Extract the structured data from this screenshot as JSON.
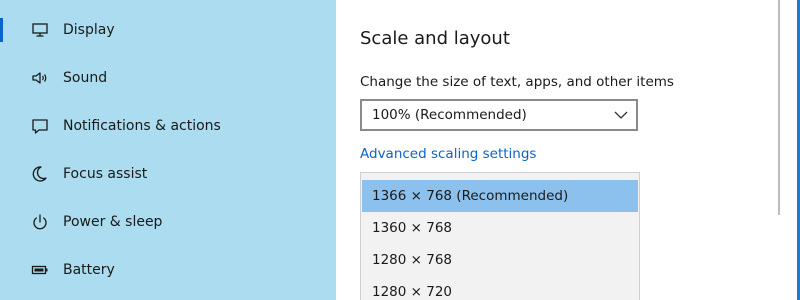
{
  "sidebar": {
    "items": [
      {
        "label": "Display",
        "icon": "monitor-icon",
        "active": true
      },
      {
        "label": "Sound",
        "icon": "speaker-icon",
        "active": false
      },
      {
        "label": "Notifications & actions",
        "icon": "notification-icon",
        "active": false
      },
      {
        "label": "Focus assist",
        "icon": "moon-icon",
        "active": false
      },
      {
        "label": "Power & sleep",
        "icon": "power-icon",
        "active": false
      },
      {
        "label": "Battery",
        "icon": "battery-icon",
        "active": false
      }
    ]
  },
  "content": {
    "section_title": "Scale and layout",
    "scale_field": {
      "label": "Change the size of text, apps, and other items",
      "selected_value": "100% (Recommended)",
      "chevron_icon": "chevron-down-icon"
    },
    "advanced_link": "Advanced scaling settings",
    "resolution_dropdown": {
      "options": [
        {
          "label": "1366 × 768 (Recommended)",
          "selected": true
        },
        {
          "label": "1360 × 768",
          "selected": false
        },
        {
          "label": "1280 × 768",
          "selected": false
        },
        {
          "label": "1280 × 720",
          "selected": false
        }
      ]
    }
  },
  "colors": {
    "sidebar_background": "#abdcef",
    "accent": "#0a64c8",
    "link": "#0a64c8",
    "dropdown_selected": "#8cc1ee",
    "dropdown_background": "#f2f2f2"
  }
}
